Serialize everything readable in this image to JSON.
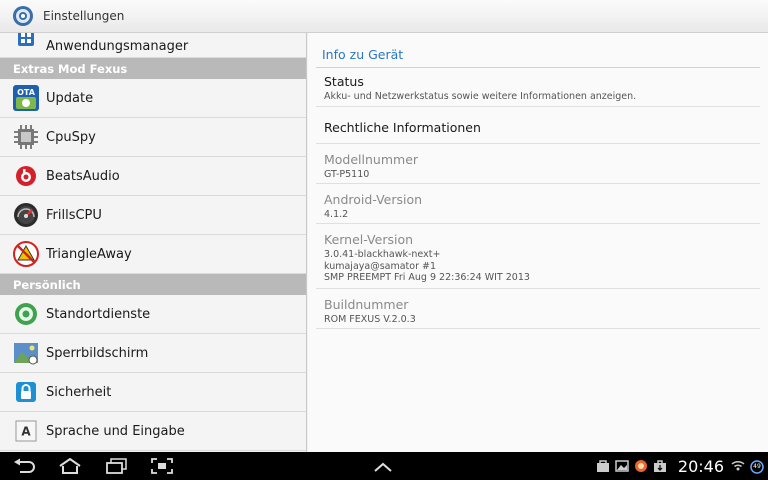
{
  "actionbar": {
    "title": "Einstellungen"
  },
  "left": {
    "partial_item": "Anwendungsmanager",
    "header1": "Extras Mod Fexus",
    "group1": [
      {
        "label": "Update",
        "icon": "ota-update-icon"
      },
      {
        "label": "CpuSpy",
        "icon": "cpu-chip-icon"
      },
      {
        "label": "BeatsAudio",
        "icon": "beats-audio-icon"
      },
      {
        "label": "FrillsCPU",
        "icon": "speedometer-icon"
      },
      {
        "label": "TriangleAway",
        "icon": "warning-triangle-icon"
      }
    ],
    "header2": "Persönlich",
    "group2": [
      {
        "label": "Standortdienste",
        "icon": "location-icon"
      },
      {
        "label": "Sperrbildschirm",
        "icon": "lockscreen-icon"
      },
      {
        "label": "Sicherheit",
        "icon": "lock-icon"
      },
      {
        "label": "Sprache und Eingabe",
        "icon": "keyboard-a-icon"
      }
    ]
  },
  "right": {
    "section": "Info zu Gerät",
    "status": {
      "title": "Status",
      "summary": "Akku- und Netzwerkstatus sowie weitere Informationen anzeigen."
    },
    "legal": {
      "title": "Rechtliche Informationen"
    },
    "model": {
      "title": "Modellnummer",
      "value": "GT-P5110"
    },
    "android": {
      "title": "Android-Version",
      "value": "4.1.2"
    },
    "kernel": {
      "title": "Kernel-Version",
      "line1": "3.0.41-blackhawk-next+",
      "line2": "kumajaya@samator #1",
      "line3": "SMP PREEMPT Fri Aug 9 22:36:24 WIT 2013"
    },
    "build": {
      "title": "Buildnummer",
      "value": "ROM FEXUS V.2.0.3"
    }
  },
  "sysbar": {
    "time": "20:46",
    "battery_level": "49"
  }
}
